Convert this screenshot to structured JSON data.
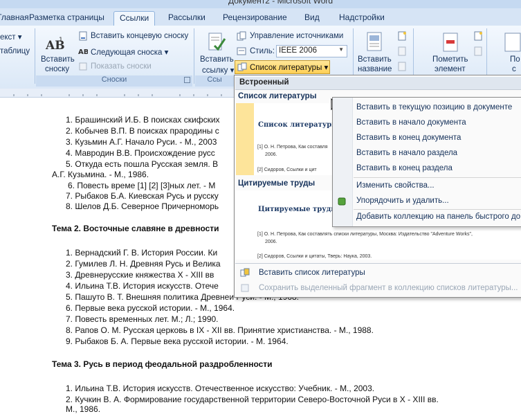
{
  "window": {
    "title": "Документ2 - Microsoft Word"
  },
  "tabs": [
    {
      "label": "Главная"
    },
    {
      "label": "Разметка страницы"
    },
    {
      "label": "Ссылки"
    },
    {
      "label": "Рассылки"
    },
    {
      "label": "Рецензирование"
    },
    {
      "label": "Вид"
    },
    {
      "label": "Надстройки"
    }
  ],
  "ribbon": {
    "toc_partial_1": "екст ▾",
    "toc_partial_2": "таблицу",
    "insert_footnote_l1": "Вставить",
    "insert_footnote_l2": "сноску",
    "insert_endnote": "Вставить концевую сноску",
    "next_footnote": "Следующая сноска ▾",
    "show_notes": "Показать сноски",
    "footnotes_group": "Сноски",
    "insert_citation_l1": "Вставить",
    "insert_citation_l2": "ссылку ▾",
    "manage_sources": "Управление источниками",
    "style_label": "Стиль:",
    "style_value": "IEEE 2006",
    "bibliography_button": "Список литературы ▾",
    "citations_group_partial": "Ссы",
    "insert_caption_l1": "Вставить",
    "insert_caption_l2": "название",
    "mark_entry_l1": "Пометить",
    "mark_entry_l2": "элемент",
    "partial_right_1": "По",
    "partial_right_2": "с"
  },
  "document": {
    "lines": [
      "1. Брашинский И.Б. В поисках скифских",
      "2. Кобычев В.П. В поисках прародины с",
      "3. Кузьмин А.Г. Начало Руси. - М., 2003",
      "4. Мавродин В.В. Происхождение русс",
      "5. Откуда есть пошла Русская земля. В",
      "А.Г. Кузьмина. - М., 1986.",
      "6. Повесть време [1] [2] [3]ных лет. - М",
      "7. Рыбаков Б.А. Киевская Русь и русску",
      "8. Шелов Д.Б. Северное Причерноморь",
      "Тема 2. Восточные славяне в древности",
      "1. Вернадский Г. В. История России. Ки",
      "2. Гумилев Л. Н. Древняя Русь и Велика",
      "3. Древнерусские княжества X - XIII вв",
      "4. Ильина Т.В. История искусств. Отече",
      "5. Пашуто В. Т. Внешняя политика Древнеи Руси. - М., 1968.",
      "6. Первые века русской истории. - М., 1964.",
      "7. Повесть временных лет. М.; Л.; 1990.",
      "8. Рапов О. М. Русская церковь в IX - XII вв. Принятие христианства. - М., 1988.",
      "9. Рыбаков Б. А. Первые века русской истории. - М. 1964.",
      "Тема 3. Русь в период феодальной раздробленности",
      "1. Ильина Т.В. История искусств. Отечественное искусство: Учебник. - М., 2003.",
      "2. Кучкин В. А. Формирование государственной территории Северо-Восточной Руси в X - XIII вв.",
      "М., 1986."
    ]
  },
  "dropdown": {
    "header": "Встроенный",
    "gallery": [
      {
        "title": "Список литературы",
        "preview_heading": "Список литературы",
        "preview_text_1": "[1] О. Н. Петрова, Как составля",
        "preview_text_2": "2006.",
        "preview_text_3": "[2] Сидоров, Ссылки и цит"
      },
      {
        "title": "Цитируемые труды",
        "preview_heading": "Цитируемые труды",
        "preview_text_1": "[1] О. Н. Петрова, Как составлять списки литературы, Москва: Издательство \"Adventure Works\",",
        "preview_text_2": "2006.",
        "preview_text_3": "[2] Сидоров, Ссылки и цитаты, Тверь: Наука, 2003."
      }
    ],
    "insert_bibliography": "Вставить список литературы",
    "save_selection": "Сохранить выделенный фрагмент в коллекцию списков литературы..."
  },
  "submenu": {
    "items": [
      "Вставить в текущую позицию в документе",
      "Вставить в начало документа",
      "Вставить в конец документа",
      "Вставить в начало раздела",
      "Вставить в конец раздела",
      "Изменить свойства...",
      "Упорядочить и удалить...",
      "Добавить коллекцию на панель быстрого до"
    ]
  }
}
